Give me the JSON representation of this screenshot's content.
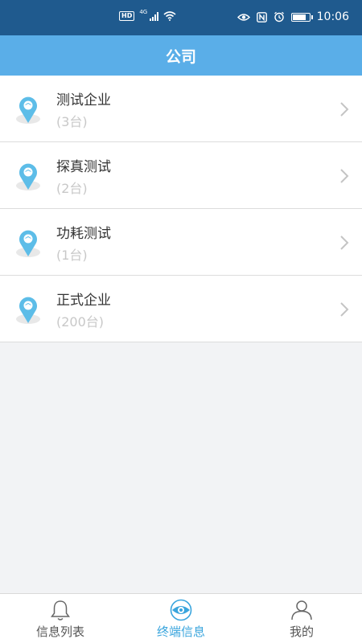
{
  "status_bar": {
    "left_badge": "HD",
    "network": "4G",
    "time": "10:06",
    "icons": [
      "wifi-icon",
      "eye-icon",
      "nfc-icon",
      "alarm-icon",
      "battery-icon"
    ]
  },
  "header": {
    "title": "公司"
  },
  "companies": [
    {
      "name": "测试企业",
      "count": "(3台)",
      "icon": "location-pin-icon"
    },
    {
      "name": "探真测试",
      "count": "(2台)",
      "icon": "location-pin-icon"
    },
    {
      "name": "功耗测试",
      "count": "(1台)",
      "icon": "location-pin-icon"
    },
    {
      "name": "正式企业",
      "count": "(200台)",
      "icon": "location-pin-icon"
    }
  ],
  "tabs": [
    {
      "label": "信息列表",
      "icon": "bell-icon",
      "active": false
    },
    {
      "label": "终端信息",
      "icon": "terminal-eye-icon",
      "active": true
    },
    {
      "label": "我的",
      "icon": "user-icon",
      "active": false
    }
  ],
  "colors": {
    "status_bar": "#1f5a8e",
    "header": "#5aaee8",
    "accent": "#3aa5dd",
    "background": "#f2f3f5"
  }
}
